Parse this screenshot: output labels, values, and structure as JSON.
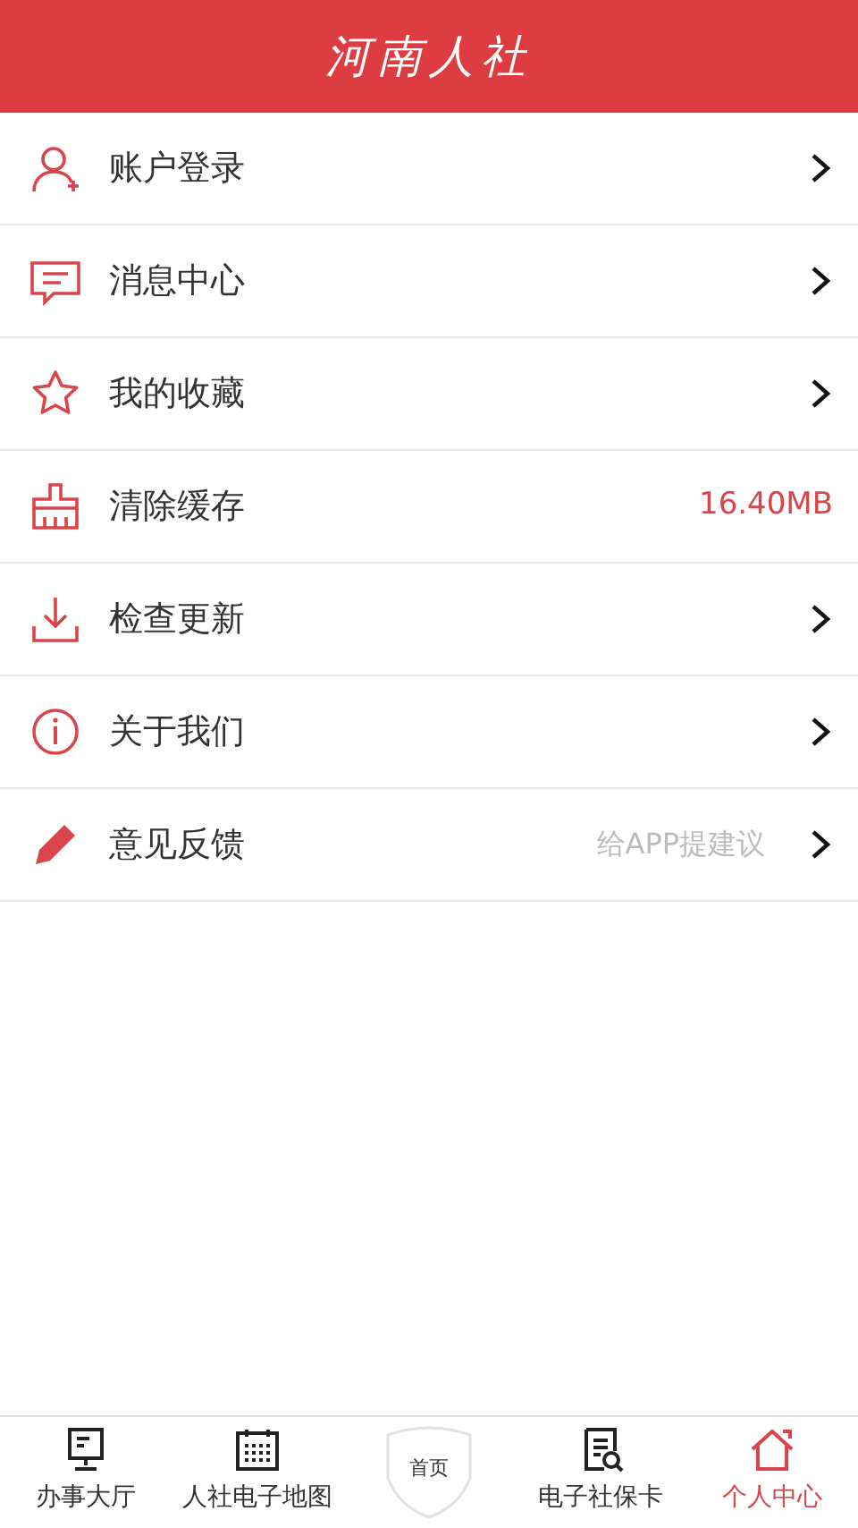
{
  "header": {
    "title": "河南人社"
  },
  "menu": [
    {
      "label": "账户登录",
      "chevron": true
    },
    {
      "label": "消息中心",
      "chevron": true
    },
    {
      "label": "我的收藏",
      "chevron": true
    },
    {
      "label": "清除缓存",
      "value": "16.40MB",
      "chevron": false
    },
    {
      "label": "检查更新",
      "chevron": true
    },
    {
      "label": "关于我们",
      "chevron": true
    },
    {
      "label": "意见反馈",
      "hint": "给APP提建议",
      "chevron": true
    }
  ],
  "tabbar": [
    {
      "kind": "tab",
      "label": "办事大厅",
      "selected": false
    },
    {
      "kind": "tab",
      "label": "人社电子地图",
      "selected": false
    },
    {
      "kind": "shield",
      "label": "首页",
      "selected": false
    },
    {
      "kind": "tab",
      "label": "电子社保卡",
      "selected": false
    },
    {
      "kind": "tab",
      "label": "个人中心",
      "selected": true
    }
  ]
}
